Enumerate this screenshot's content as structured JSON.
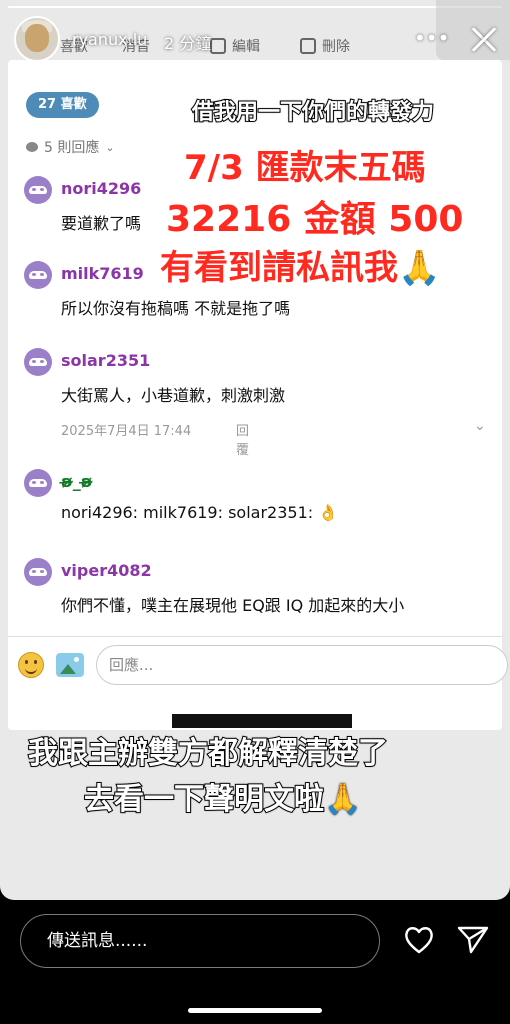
{
  "header": {
    "username": "ryanux.lu",
    "time_ago": "2 分鐘",
    "toolbar": {
      "like_label": "喜歡",
      "message_label": "消音",
      "edit_label": "編輯",
      "delete_label": "刪除"
    },
    "more": "•••"
  },
  "post": {
    "likes_badge": "27 喜歡",
    "replies_count": "5 則回應",
    "comments": [
      {
        "user": "nori4296",
        "text": "要道歉了嗎"
      },
      {
        "user": "milk7619",
        "text": "所以你沒有拖稿嗎 不就是拖了嗎"
      },
      {
        "user": "solar2351",
        "text": "大街罵人，小巷道歉，刺激刺激",
        "timestamp": "2025年7月4日 17:44",
        "reply_label": "回覆"
      },
      {
        "user": "ʚ̴̶̷̷_ʚ̴̶̷̷",
        "text": "nori4296: milk7619: solar2351: 👌"
      },
      {
        "user": "viper4082",
        "text": "你們不懂，噗主在展現他 EQ跟 IQ 加起來的大小"
      }
    ],
    "reply_placeholder": "回應..."
  },
  "overlay": {
    "line1": "借我用一下你們的轉發力",
    "line2": "7/3 匯款末五碼",
    "line3": "32216 金額 500",
    "line4": "有看到請私訊我🙏",
    "line5": "我跟主辦雙方都解釋清楚了",
    "line6": "去看一下聲明文啦🙏"
  },
  "bottom": {
    "message_placeholder": "傳送訊息......"
  },
  "colors": {
    "username_purple": "#8c35a8",
    "accent_red": "#ff2a1f",
    "likes_blue": "#4f8bb8"
  }
}
